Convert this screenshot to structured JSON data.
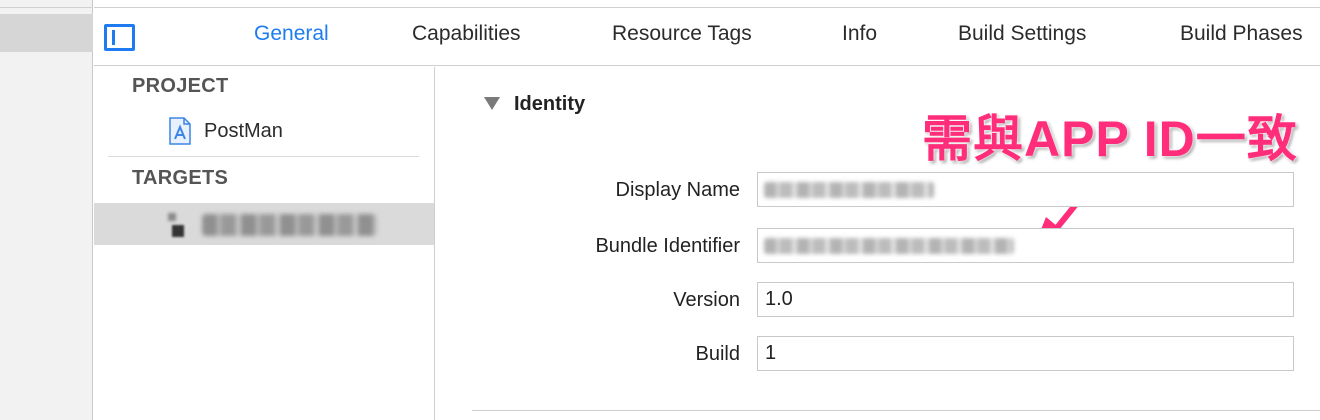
{
  "tabs": [
    {
      "label": "General",
      "active": true
    },
    {
      "label": "Capabilities"
    },
    {
      "label": "Resource Tags"
    },
    {
      "label": "Info"
    },
    {
      "label": "Build Settings"
    },
    {
      "label": "Build Phases"
    }
  ],
  "sidebar": {
    "project_heading": "PROJECT",
    "project_item": {
      "label": "PostMan",
      "icon": "xcode-project-icon"
    },
    "targets_heading": "TARGETS",
    "target_item": {
      "label_redacted": true,
      "icon": "app-target-icon"
    }
  },
  "identity": {
    "section_title": "Identity",
    "fields": {
      "display_name": {
        "label": "Display Name",
        "redacted": true
      },
      "bundle_identifier": {
        "label": "Bundle Identifier",
        "redacted": true
      },
      "version": {
        "label": "Version",
        "value": "1.0"
      },
      "build": {
        "label": "Build",
        "value": "1"
      }
    }
  },
  "annotation": {
    "text": "需與APP ID一致"
  },
  "colors": {
    "accent": "#1e7cf2",
    "annotation": "#ff2d7a",
    "selected_row": "#dadada"
  }
}
